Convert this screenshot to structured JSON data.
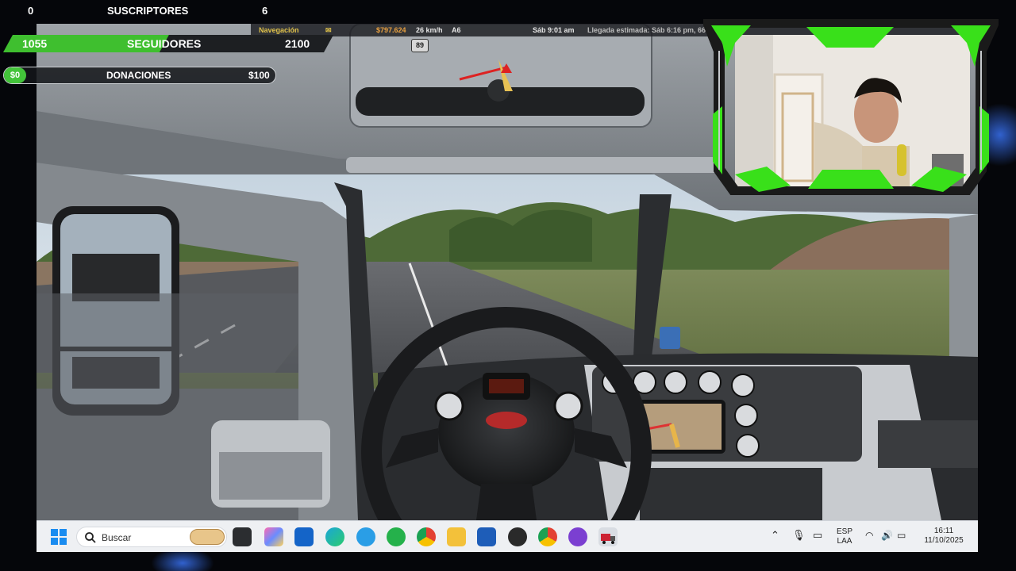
{
  "overlay": {
    "subscribers": {
      "current": "0",
      "label": "SUSCRIPTORES",
      "goal": "6"
    },
    "followers": {
      "current": "1055",
      "label": "SEGUIDORES",
      "goal": "2100",
      "progress": 0.502
    },
    "donations": {
      "current": "$0",
      "label": "DONACIONES",
      "goal": "$100",
      "progress": 0.0
    },
    "accent_color": "#3fbf2f"
  },
  "game_hud": {
    "navigation": "Navegación",
    "money": "$797.624",
    "speed": "26 km/h",
    "road": "A6",
    "time": "Sáb 9:01 am",
    "eta": "Llegada estimada: Sáb 6:16 pm, 66",
    "speed_sign": "89"
  },
  "taskbar": {
    "search_placeholder": "Buscar",
    "language_line1": "ESP",
    "language_line2": "LAA",
    "clock_time": "16:11",
    "clock_date": "11/10/2025",
    "apps": [
      "windows-start",
      "search",
      "browser-shortcut",
      "task-view",
      "copilot",
      "microsoft-store",
      "edge",
      "telegram",
      "whatsapp",
      "chrome",
      "file-explorer",
      "word",
      "obs",
      "chrome-profile",
      "podcast-app",
      "truck-game"
    ]
  },
  "cam_frame_color": "#39e01a"
}
